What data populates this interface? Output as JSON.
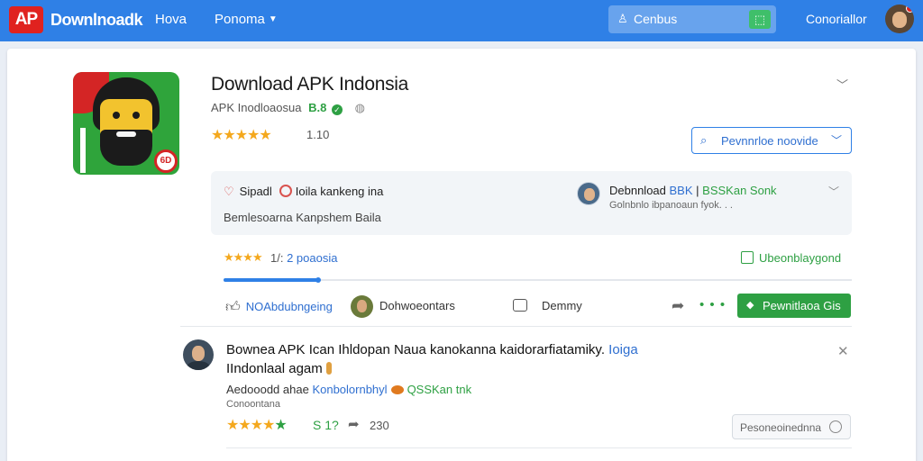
{
  "topbar": {
    "logo": "AP",
    "brand": "Downlnoadk",
    "nav_home": "Hova",
    "nav_popular": "Ponoma",
    "search_label": "Cenbus",
    "account_label": "Conoriallor"
  },
  "app": {
    "title": "Download APK Indonsia",
    "developer": "APK Inodloaosua",
    "version": "B.8",
    "rating_stars": "★★★★★",
    "rating_value": "1.10",
    "icon_badge": "6D",
    "variant_select": "Pevnnrloe noovide"
  },
  "info_panel": {
    "line1_a": "Sipadl",
    "line1_b": "Ioila kankeng ina",
    "line2": "Bemlesoarna Kanpshem Baila",
    "download_label": "Debnnload",
    "download_apk": "BBK",
    "download_sep": "|",
    "download_green": "BSSKan Sonk",
    "download_sub": "Golnbnlo ibpanoaun fyok. . ."
  },
  "progress": {
    "stars": "★★★★",
    "label_prefix": "1/:",
    "label_blue": "2 poaosia",
    "fill_fraction": 0.15,
    "ready_label": "Ubeonblaygond"
  },
  "actions": {
    "like_label": "NOAbdubngeing",
    "user_label": "Dohwoeontars",
    "comment_label": "Demmy",
    "more": "• • •",
    "download_button": "Pewnitlaoa Gis"
  },
  "comment": {
    "title_line1": "Bownea APK Ican Ihldopan Naua kanokanna kaidorarfiatamiky.",
    "title_tag": "Ioiga",
    "title_line2": "IIndonlaal agam",
    "line3_a": "Aedooodd ahae",
    "line3_blue": "Konbolornbhyl",
    "line3_green": "QSSKan tnk",
    "line4": "Conoontana",
    "stars_gold": "★★★★",
    "stars_green": "★",
    "score": "S 1?",
    "count": "230",
    "reply_button": "Pesoneoinednna"
  }
}
